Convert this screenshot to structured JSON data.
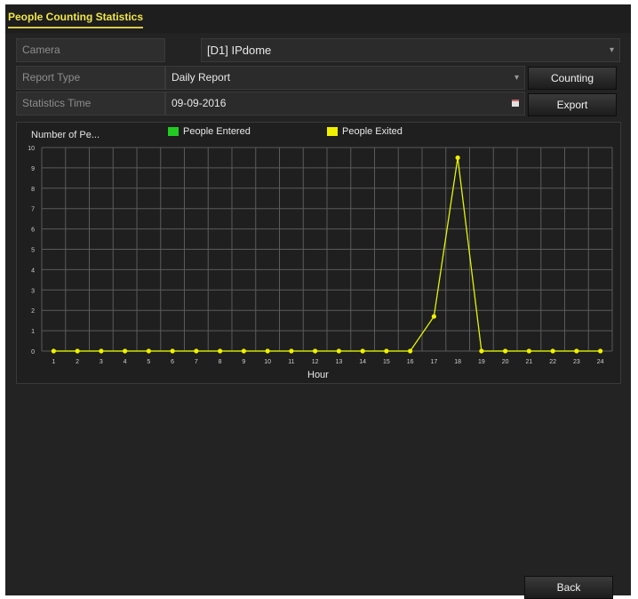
{
  "tab": {
    "label": "People Counting Statistics"
  },
  "camera": {
    "label": "Camera",
    "value": "[D1] IPdome"
  },
  "report_type": {
    "label": "Report Type",
    "value": "Daily Report"
  },
  "statistics_time": {
    "label": "Statistics Time",
    "value": "09-09-2016"
  },
  "buttons": {
    "counting": "Counting",
    "export": "Export",
    "back": "Back"
  },
  "chart_data": {
    "type": "line",
    "ylabel": "Number of Pe...",
    "xlabel": "Hour",
    "ylim": [
      0,
      10
    ],
    "yticks": [
      "0",
      "1",
      "2",
      "3",
      "4",
      "5",
      "6",
      "7",
      "8",
      "9",
      "10"
    ],
    "categories": [
      "1",
      "2",
      "3",
      "4",
      "5",
      "6",
      "7",
      "8",
      "9",
      "10",
      "11",
      "12",
      "13",
      "14",
      "15",
      "16",
      "17",
      "18",
      "19",
      "20",
      "21",
      "22",
      "23",
      "24"
    ],
    "series": [
      {
        "name": "People Entered",
        "color": "#22cc22",
        "values": [
          0,
          0,
          0,
          0,
          0,
          0,
          0,
          0,
          0,
          0,
          0,
          0,
          0,
          0,
          0,
          0,
          1.7,
          9.5,
          0,
          0,
          0,
          0,
          0,
          0
        ]
      },
      {
        "name": "People Exited",
        "color": "#f0f000",
        "values": [
          0,
          0,
          0,
          0,
          0,
          0,
          0,
          0,
          0,
          0,
          0,
          0,
          0,
          0,
          0,
          0,
          1.7,
          9.5,
          0,
          0,
          0,
          0,
          0,
          0
        ]
      }
    ],
    "grid": true,
    "legend": "top"
  }
}
